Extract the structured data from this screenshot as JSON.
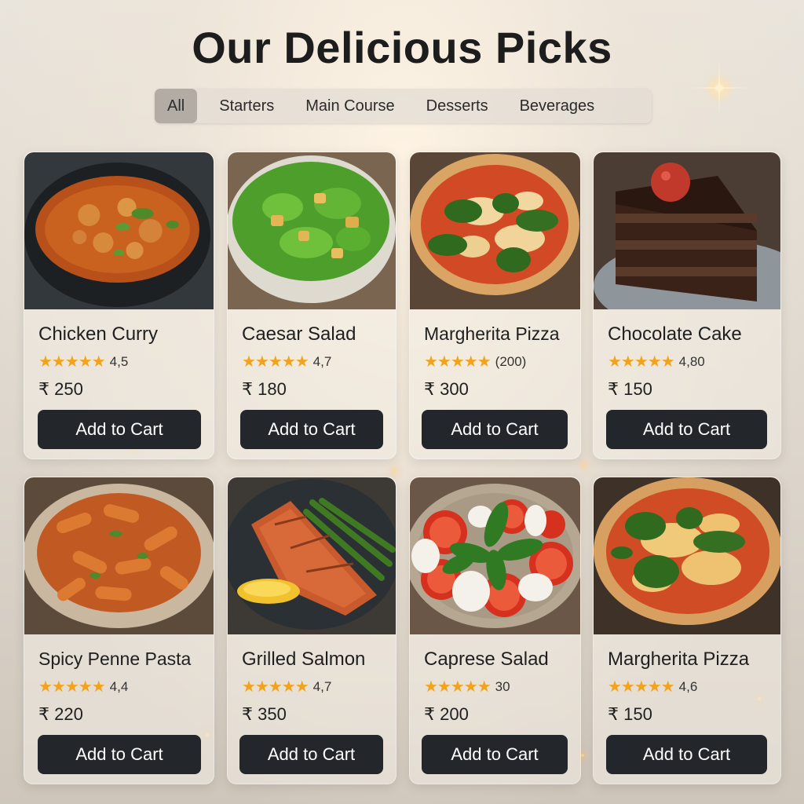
{
  "title": "Our Delicious Picks",
  "tabs": [
    {
      "label": "All",
      "active": true
    },
    {
      "label": "Starters",
      "active": false
    },
    {
      "label": "Main Course",
      "active": false
    },
    {
      "label": "Desserts",
      "active": false
    },
    {
      "label": "Beverages",
      "active": false
    }
  ],
  "colors": {
    "button_bg": "#23272c",
    "star": "#f2a31b",
    "active_tab": "#b3aca5"
  },
  "items": [
    {
      "name": "Chicken Curry",
      "stars": "★★★★★",
      "rating": "4,5",
      "price": "₹ 250",
      "button": "Add to Cart",
      "icon": "chicken-curry-image"
    },
    {
      "name": "Caesar Salad",
      "stars": "★★★★★",
      "rating": "4,7",
      "price": "₹ 180",
      "button": "Add to Cart",
      "icon": "caesar-salad-image"
    },
    {
      "name": "Margherita Pizza",
      "stars": "★★★★★",
      "rating": "(200)",
      "price": "₹ 300",
      "button": "Add to Cart",
      "icon": "margherita-pizza-image"
    },
    {
      "name": "Chocolate Cake",
      "stars": "★★★★★",
      "rating": "4,80",
      "price": "₹ 150",
      "button": "Add to Cart",
      "icon": "chocolate-cake-image"
    },
    {
      "name": "Spicy Penne Pasta",
      "stars": "★★★★★",
      "rating": "4,4",
      "price": "₹ 220",
      "button": "Add to Cart",
      "icon": "penne-pasta-image"
    },
    {
      "name": "Grilled Salmon",
      "stars": "★★★★★",
      "rating": "4,7",
      "price": "₹ 350",
      "button": "Add to Cart",
      "icon": "grilled-salmon-image"
    },
    {
      "name": "Caprese Salad",
      "stars": "★★★★★",
      "rating": "30",
      "price": "₹ 200",
      "button": "Add to Cart",
      "icon": "caprese-salad-image"
    },
    {
      "name": "Margherita Pizza",
      "stars": "★★★★★",
      "rating": "4,6",
      "price": "₹ 150",
      "button": "Add to Cart",
      "icon": "margherita-pizza-image"
    }
  ]
}
